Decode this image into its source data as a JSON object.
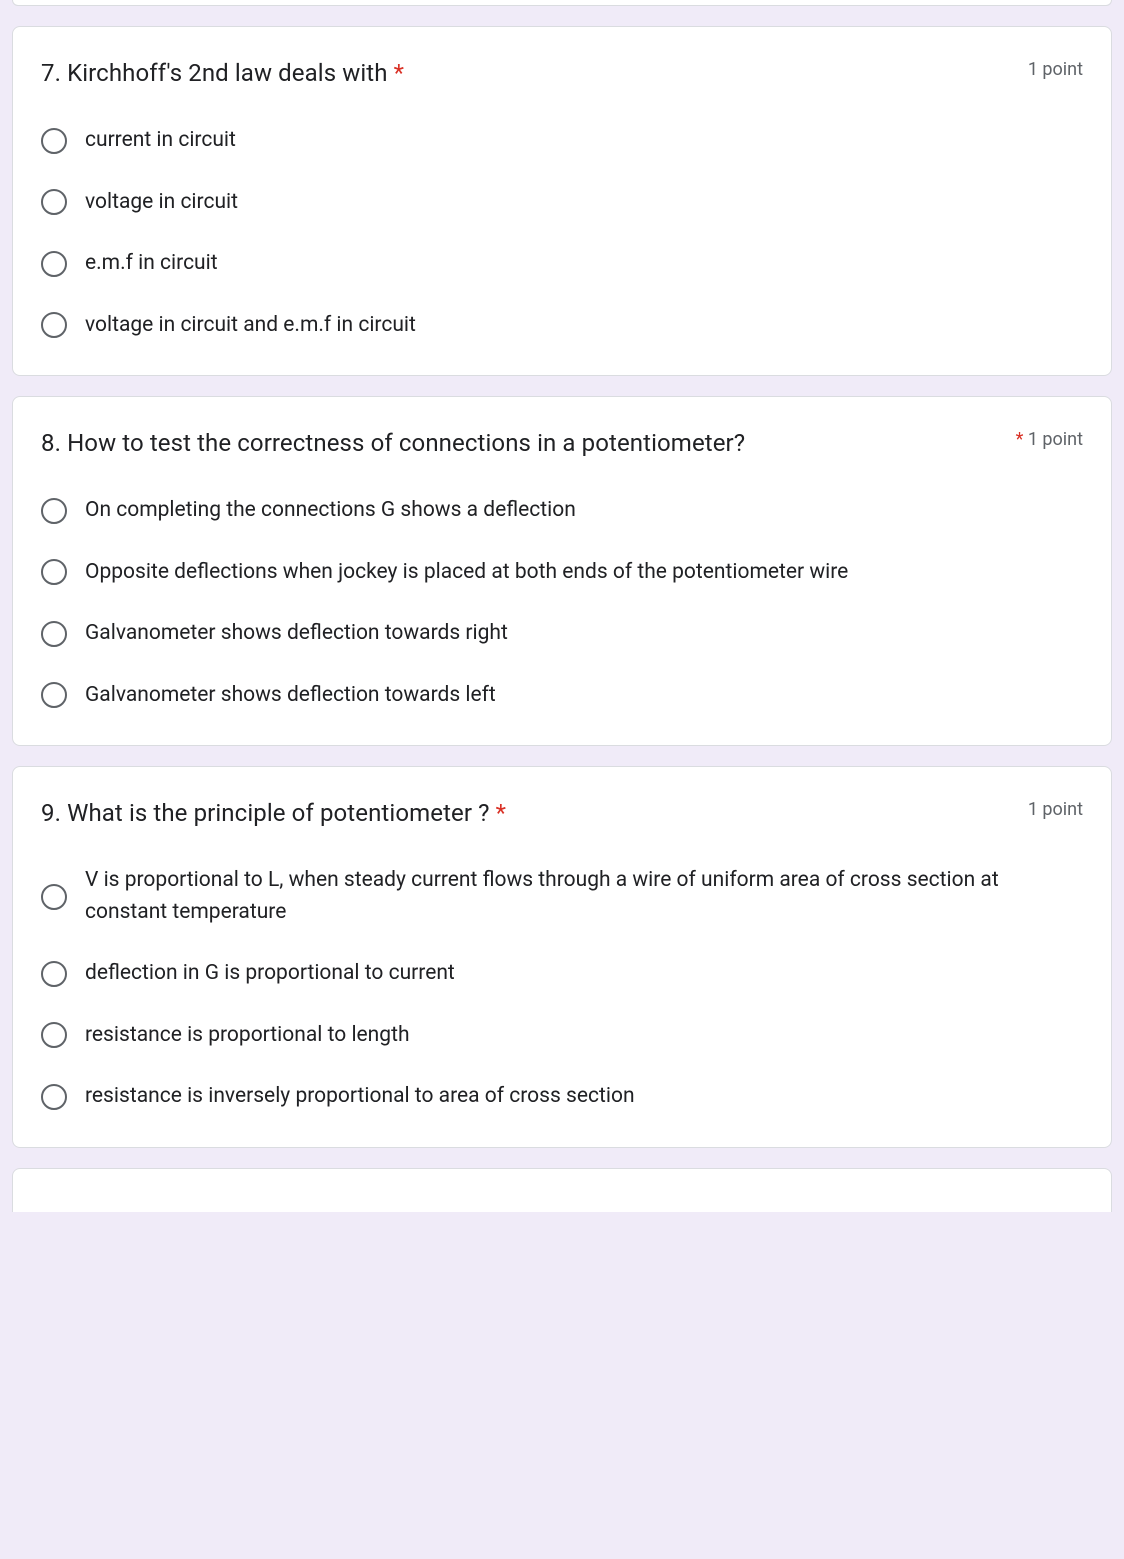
{
  "questions": [
    {
      "title": "7. Kirchhoff's 2nd law deals with ",
      "required": "*",
      "points": "1 point",
      "options": [
        "current in circuit",
        "voltage in circuit",
        "e.m.f in circuit",
        "voltage in circuit and e.m.f in circuit"
      ]
    },
    {
      "title": "8. How to test the correctness of connections in a potentiometer?",
      "required": "*",
      "points": "1 point",
      "options": [
        "On completing the connections G shows a deflection",
        "Opposite deflections when jockey is placed at both ends of the potentiometer wire",
        "Galvanometer shows deflection towards right",
        "Galvanometer shows deflection towards left"
      ]
    },
    {
      "title": "9. What is the principle of potentiometer ? ",
      "required": "*",
      "points": "1 point",
      "options": [
        "V is proportional to L, when steady current flows through a wire of uniform area of cross section at constant temperature",
        "deflection in G is proportional to current",
        "resistance is proportional to length",
        "resistance is inversely proportional to area of cross section"
      ]
    }
  ]
}
